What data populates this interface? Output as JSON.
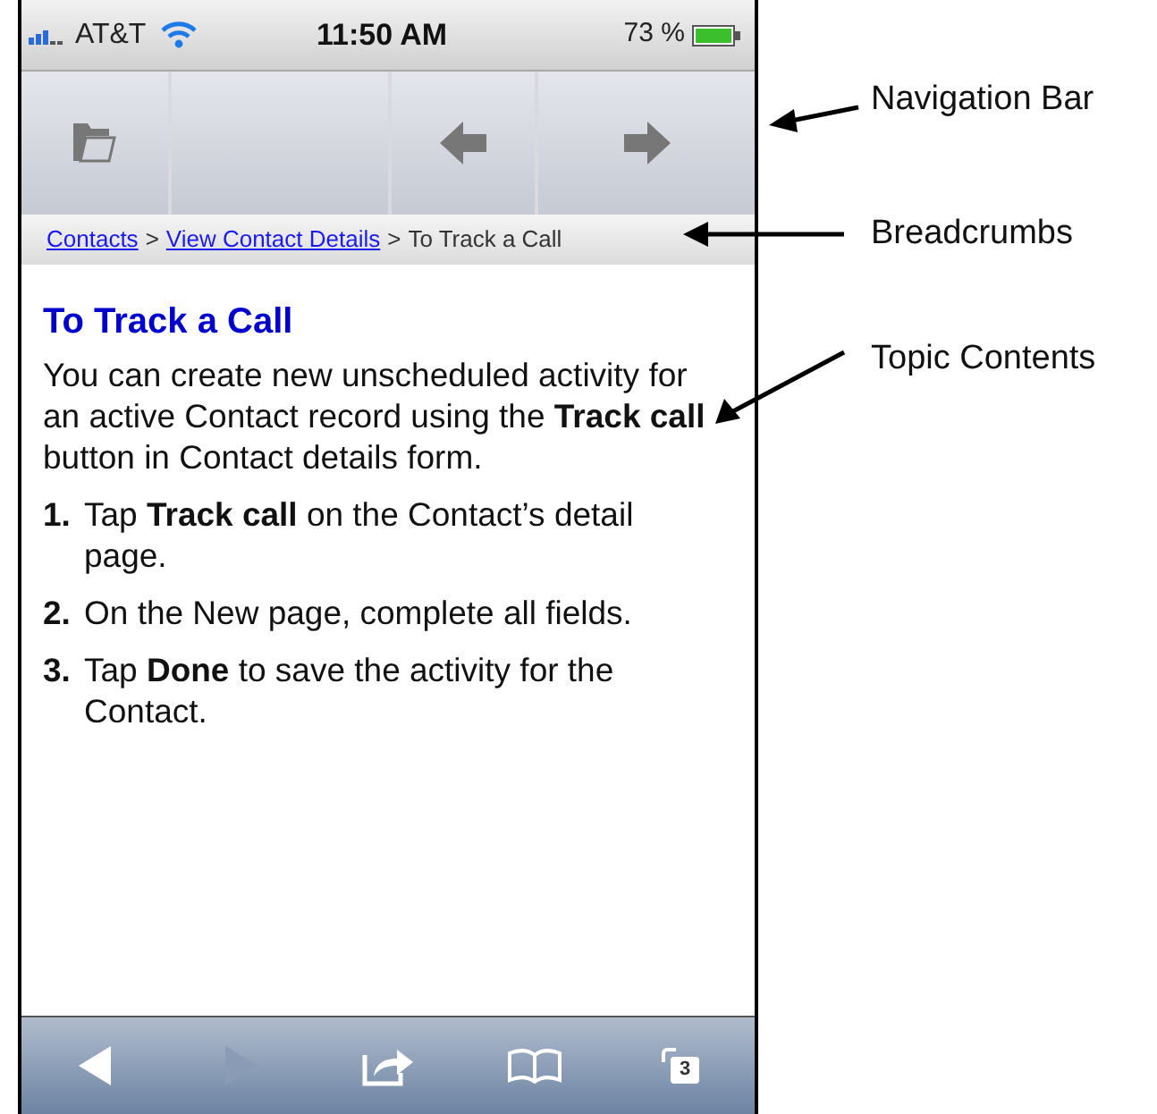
{
  "status_bar": {
    "carrier": "AT&T",
    "time": "11:50 AM",
    "battery": "73 %"
  },
  "nav_bar": {
    "buttons": [
      {
        "kind": "folder"
      },
      {
        "kind": "blank"
      },
      {
        "kind": "back"
      },
      {
        "kind": "forward"
      }
    ]
  },
  "breadcrumbs": {
    "items": [
      {
        "label": "Contacts",
        "link": true
      },
      {
        "label": "View Contact Details",
        "link": true
      },
      {
        "label": "To Track a Call",
        "link": false
      }
    ],
    "separators": [
      ">",
      ">"
    ]
  },
  "topic": {
    "title": "To Track a Call",
    "intro": "You can create new unscheduled activity for an active Contact record using the **Track call** button in Contact details form.",
    "steps": [
      {
        "number": "1.",
        "text": "Tap **Track call** on the Contact’s detail page."
      },
      {
        "number": "2.",
        "text": "On the New page, complete all fields."
      },
      {
        "number": "3.",
        "text": "Tap **Done** to save the activity for the Contact."
      }
    ]
  },
  "toolbar": {
    "buttons": [
      {
        "kind": "back",
        "disabled": false
      },
      {
        "kind": "forward",
        "disabled": true
      },
      {
        "kind": "share",
        "disabled": false
      },
      {
        "kind": "bookmarks",
        "disabled": false
      },
      {
        "kind": "pages",
        "disabled": false,
        "badge": "3"
      }
    ]
  },
  "annotations": [
    {
      "label": "Navigation Bar"
    },
    {
      "label": "Breadcrumbs"
    },
    {
      "label": "Topic Contents"
    }
  ]
}
